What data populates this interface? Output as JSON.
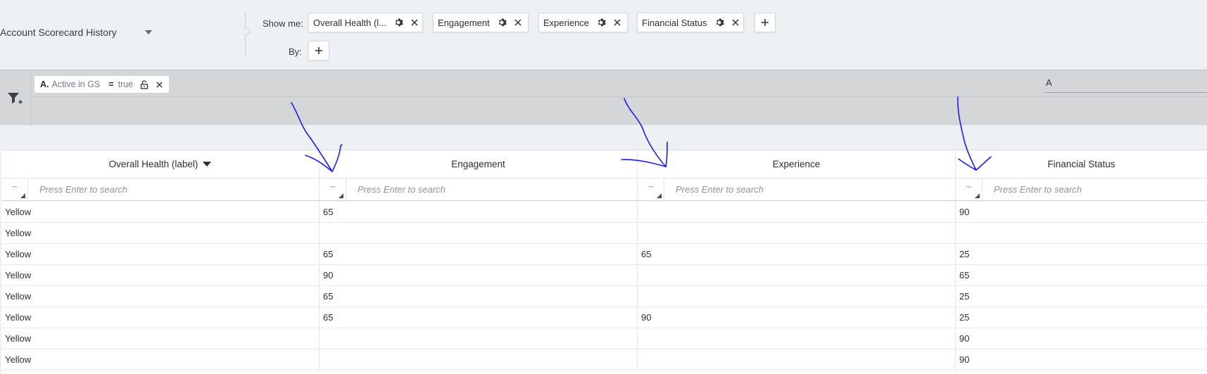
{
  "toolbar": {
    "report_name": "Account Scorecard History",
    "show_me_label": "Show me:",
    "by_label": "By:",
    "measures": [
      {
        "label": "Overall Health (l..."
      },
      {
        "label": "Engagement"
      },
      {
        "label": "Experience"
      },
      {
        "label": "Financial Status"
      }
    ]
  },
  "filters": {
    "chips": [
      {
        "letter": "A.",
        "field": "Active in GS",
        "operator": "=",
        "value": "true"
      }
    ],
    "logic_value": "A"
  },
  "grid": {
    "columns": [
      {
        "label": "Overall Health (label)",
        "sorted": "desc"
      },
      {
        "label": "Engagement"
      },
      {
        "label": "Experience"
      },
      {
        "label": "Financial Status"
      }
    ],
    "search_placeholder": "Press Enter to search",
    "operator_glyph": "~",
    "rows": [
      [
        "Yellow",
        "65",
        "",
        "90"
      ],
      [
        "Yellow",
        "",
        "",
        ""
      ],
      [
        "Yellow",
        "65",
        "65",
        "25"
      ],
      [
        "Yellow",
        "90",
        "",
        "65"
      ],
      [
        "Yellow",
        "65",
        "",
        "25"
      ],
      [
        "Yellow",
        "65",
        "90",
        "25"
      ],
      [
        "Yellow",
        "",
        "",
        "90"
      ],
      [
        "Yellow",
        "",
        "",
        "90"
      ]
    ]
  },
  "annotation": {
    "color": "#1a1aff"
  }
}
